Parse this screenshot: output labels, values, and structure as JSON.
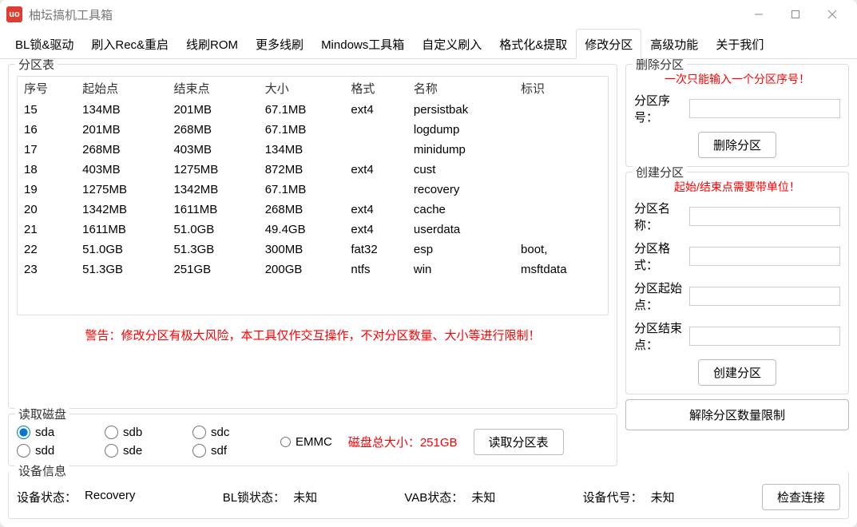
{
  "app": {
    "icon_text": "uo",
    "title": "柚坛搞机工具箱"
  },
  "tabs": [
    "BL锁&驱动",
    "刷入Rec&重启",
    "线刷ROM",
    "更多线刷",
    "Mindows工具箱",
    "自定义刷入",
    "格式化&提取",
    "修改分区",
    "高级功能",
    "关于我们"
  ],
  "active_tab_index": 7,
  "partition_table": {
    "title": "分区表",
    "headers": [
      "序号",
      "起始点",
      "结束点",
      "大小",
      "格式",
      "名称",
      "标识"
    ],
    "rows": [
      [
        "15",
        "134MB",
        "201MB",
        "67.1MB",
        "ext4",
        "persistbak",
        ""
      ],
      [
        "16",
        "201MB",
        "268MB",
        "67.1MB",
        "",
        "logdump",
        ""
      ],
      [
        "17",
        "268MB",
        "403MB",
        "134MB",
        "",
        "minidump",
        ""
      ],
      [
        "18",
        "403MB",
        "1275MB",
        "872MB",
        "ext4",
        "cust",
        ""
      ],
      [
        "19",
        "1275MB",
        "1342MB",
        "67.1MB",
        "",
        "recovery",
        ""
      ],
      [
        "20",
        "1342MB",
        "1611MB",
        "268MB",
        "ext4",
        "cache",
        ""
      ],
      [
        "21",
        "1611MB",
        "51.0GB",
        "49.4GB",
        "ext4",
        "userdata",
        ""
      ],
      [
        "22",
        "51.0GB",
        "51.3GB",
        "300MB",
        "fat32",
        "esp",
        "boot,"
      ],
      [
        "23",
        "51.3GB",
        "251GB",
        "200GB",
        "ntfs",
        "win",
        "msftdata"
      ]
    ],
    "warning": "警告：修改分区有极大风险，本工具仅作交互操作，不对分区数量、大小等进行限制！"
  },
  "read_disk": {
    "title": "读取磁盘",
    "options": [
      "sda",
      "sdb",
      "sdc",
      "sdd",
      "sde",
      "sdf"
    ],
    "selected": "sda",
    "emmc": "EMMC",
    "disk_size_label": "磁盘总大小：",
    "disk_size_value": "251GB",
    "read_btn": "读取分区表"
  },
  "delete_partition": {
    "title": "删除分区",
    "hint": "一次只能输入一个分区序号！",
    "seq_label": "分区序号：",
    "btn": "删除分区"
  },
  "create_partition": {
    "title": "创建分区",
    "hint": "起始/结束点需要带单位！",
    "name_label": "分区名称：",
    "format_label": "分区格式：",
    "start_label": "分区起始点：",
    "end_label": "分区结束点：",
    "btn": "创建分区"
  },
  "unlock_limit_btn": "解除分区数量限制",
  "device_info": {
    "title": "设备信息",
    "status_label": "设备状态：",
    "status_value": "Recovery",
    "bl_label": "BL锁状态：",
    "bl_value": "未知",
    "vab_label": "VAB状态：",
    "vab_value": "未知",
    "code_label": "设备代号：",
    "code_value": "未知",
    "check_btn": "检查连接"
  }
}
